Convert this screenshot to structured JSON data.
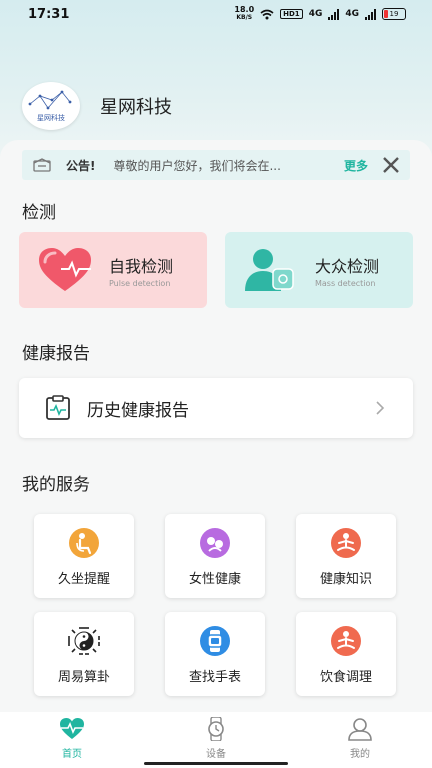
{
  "status_bar": {
    "time": "17:31",
    "net_speed_top": "18.0",
    "net_speed_unit": "KB/S",
    "hd": "HD1",
    "sig1": "4G",
    "sig2": "4G",
    "battery": "19"
  },
  "brand": {
    "name": "星网科技",
    "logo_text": "星网科技"
  },
  "notice": {
    "label": "公告!",
    "text": "尊敬的用户您好，我们将会在...",
    "more": "更多"
  },
  "detect": {
    "title": "检测",
    "self": {
      "title": "自我检测",
      "subtitle": "Pulse detection"
    },
    "mass": {
      "title": "大众检测",
      "subtitle": "Mass detection"
    }
  },
  "report": {
    "section_title": "健康报告",
    "item_label": "历史健康报告"
  },
  "services": {
    "title": "我的服务",
    "items": [
      {
        "label": "久坐提醒",
        "icon": "sitting-icon",
        "color": "#f2a53a"
      },
      {
        "label": "女性健康",
        "icon": "female-health-icon",
        "color": "#b86be0"
      },
      {
        "label": "健康知识",
        "icon": "meditation-icon",
        "color": "#ef6a4e"
      },
      {
        "label": "周易算卦",
        "icon": "yin-yang-icon",
        "color": "#222222"
      },
      {
        "label": "查找手表",
        "icon": "watch-icon",
        "color": "#2f8de4"
      },
      {
        "label": "饮食调理",
        "icon": "diet-icon",
        "color": "#f06a4f"
      }
    ]
  },
  "bottom_nav": {
    "tabs": [
      {
        "label": "首页",
        "icon": "heartbeat-icon",
        "active": true
      },
      {
        "label": "设备",
        "icon": "watch-icon",
        "active": false
      },
      {
        "label": "我的",
        "icon": "user-icon",
        "active": false
      }
    ]
  },
  "colors": {
    "accent": "#20b5a0",
    "self_card": "#fbd9da",
    "mass_card": "#d6f1ef"
  }
}
